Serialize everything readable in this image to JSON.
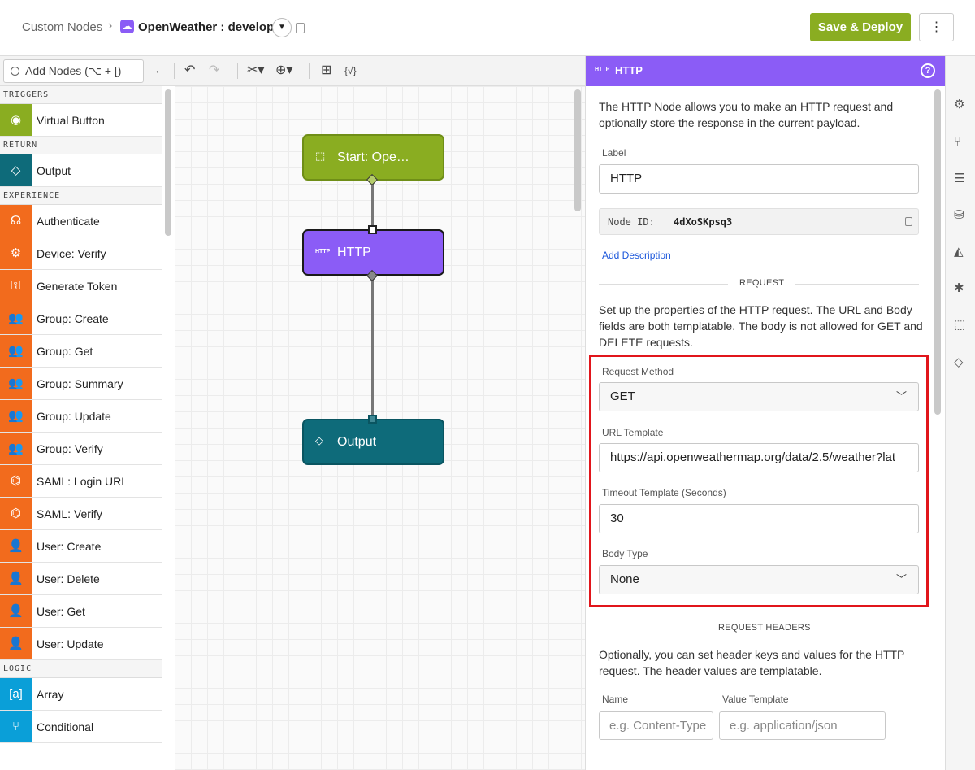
{
  "header": {
    "breadcrumb_root": "Custom Nodes",
    "breadcrumb_sep": "›",
    "flow_name": "OpenWeather : develop",
    "save_label": "Save & Deploy",
    "more_label": "⋮",
    "flow_icon": "cloud-icon"
  },
  "toolbar": {
    "search_placeholder": "Add Nodes (⌥ + [)"
  },
  "palette": {
    "sections": [
      {
        "title": "TRIGGERS",
        "items": [
          {
            "label": "Virtual Button",
            "color": "#8aad21",
            "icon": "◉"
          }
        ]
      },
      {
        "title": "RETURN",
        "items": [
          {
            "label": "Output",
            "color": "#0e6b7a",
            "icon": "◇"
          }
        ]
      },
      {
        "title": "EXPERIENCE",
        "items": [
          {
            "label": "Authenticate",
            "color": "#f26b1d",
            "icon": "☊"
          },
          {
            "label": "Device: Verify",
            "color": "#f26b1d",
            "icon": "⚙"
          },
          {
            "label": "Generate Token",
            "color": "#f26b1d",
            "icon": "⚿"
          },
          {
            "label": "Group: Create",
            "color": "#f26b1d",
            "icon": "👥"
          },
          {
            "label": "Group: Get",
            "color": "#f26b1d",
            "icon": "👥"
          },
          {
            "label": "Group: Summary",
            "color": "#f26b1d",
            "icon": "👥"
          },
          {
            "label": "Group: Update",
            "color": "#f26b1d",
            "icon": "👥"
          },
          {
            "label": "Group: Verify",
            "color": "#f26b1d",
            "icon": "👥"
          },
          {
            "label": "SAML: Login URL",
            "color": "#f26b1d",
            "icon": "⌬"
          },
          {
            "label": "SAML: Verify",
            "color": "#f26b1d",
            "icon": "⌬"
          },
          {
            "label": "User: Create",
            "color": "#f26b1d",
            "icon": "👤"
          },
          {
            "label": "User: Delete",
            "color": "#f26b1d",
            "icon": "👤"
          },
          {
            "label": "User: Get",
            "color": "#f26b1d",
            "icon": "👤"
          },
          {
            "label": "User: Update",
            "color": "#f26b1d",
            "icon": "👤"
          }
        ]
      },
      {
        "title": "LOGIC",
        "items": [
          {
            "label": "Array",
            "color": "#0a9fd8",
            "icon": "[a]"
          },
          {
            "label": "Conditional",
            "color": "#0a9fd8",
            "icon": "⑂"
          }
        ]
      }
    ]
  },
  "canvas": {
    "nodes": {
      "start": {
        "label": "Start: Ope…",
        "color": "#8aad21"
      },
      "http": {
        "label": "HTTP",
        "badge": "HTTP",
        "color": "#8b5cf6"
      },
      "output": {
        "label": "Output",
        "color": "#0e6b7a"
      }
    }
  },
  "props": {
    "header_badge": "HTTP",
    "title": "HTTP",
    "help": "?",
    "description": "The HTTP Node allows you to make an HTTP request and optionally store the response in the current payload.",
    "label_label": "Label",
    "label_value": "HTTP",
    "node_id_key": "Node ID:",
    "node_id_value": "4dXoSKpsq3",
    "add_description": "Add Description",
    "request_heading": "REQUEST",
    "request_text": "Set up the properties of the HTTP request. The URL and Body fields are both templatable. The body is not allowed for GET and DELETE requests.",
    "method_label": "Request Method",
    "method_value": "GET",
    "url_label": "URL Template",
    "url_value": "https://api.openweathermap.org/data/2.5/weather?lat",
    "timeout_label": "Timeout Template (Seconds)",
    "timeout_value": "30",
    "body_type_label": "Body Type",
    "body_type_value": "None",
    "headers_heading": "REQUEST HEADERS",
    "headers_text": "Optionally, you can set header keys and values for the HTTP request. The header values are templatable.",
    "name_label": "Name",
    "value_label": "Value Template",
    "name_placeholder": "e.g. Content-Type",
    "value_placeholder": "e.g. application/json"
  },
  "colors": {
    "accent": "#8b5cf6",
    "save": "#8aad21",
    "experience": "#f26b1d",
    "highlight": "#e1151b"
  }
}
